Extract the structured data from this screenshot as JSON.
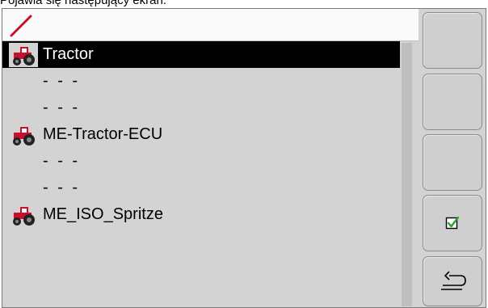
{
  "caption": "Pojawia się następujący ekran:",
  "list": {
    "rows": [
      {
        "label": "Tractor",
        "icon": "tractor-icon",
        "selected": true
      },
      {
        "label": "- - -"
      },
      {
        "label": "- - -"
      },
      {
        "label": "ME-Tractor-ECU",
        "icon": "tractor-icon"
      },
      {
        "label": "- - -"
      },
      {
        "label": "- - -"
      },
      {
        "label": "ME_ISO_Spritze",
        "icon": "tractor-icon"
      }
    ]
  },
  "topbar": {
    "icon": "pencil-icon"
  },
  "softkeys": [
    {
      "icon": ""
    },
    {
      "icon": ""
    },
    {
      "icon": ""
    },
    {
      "icon": "checkbox-checked-icon"
    },
    {
      "icon": "return-icon"
    }
  ],
  "colors": {
    "icon_red": "#c8102e",
    "check_green": "#2e9e2e",
    "selection": "#000000",
    "background": "#d3d3d3"
  }
}
